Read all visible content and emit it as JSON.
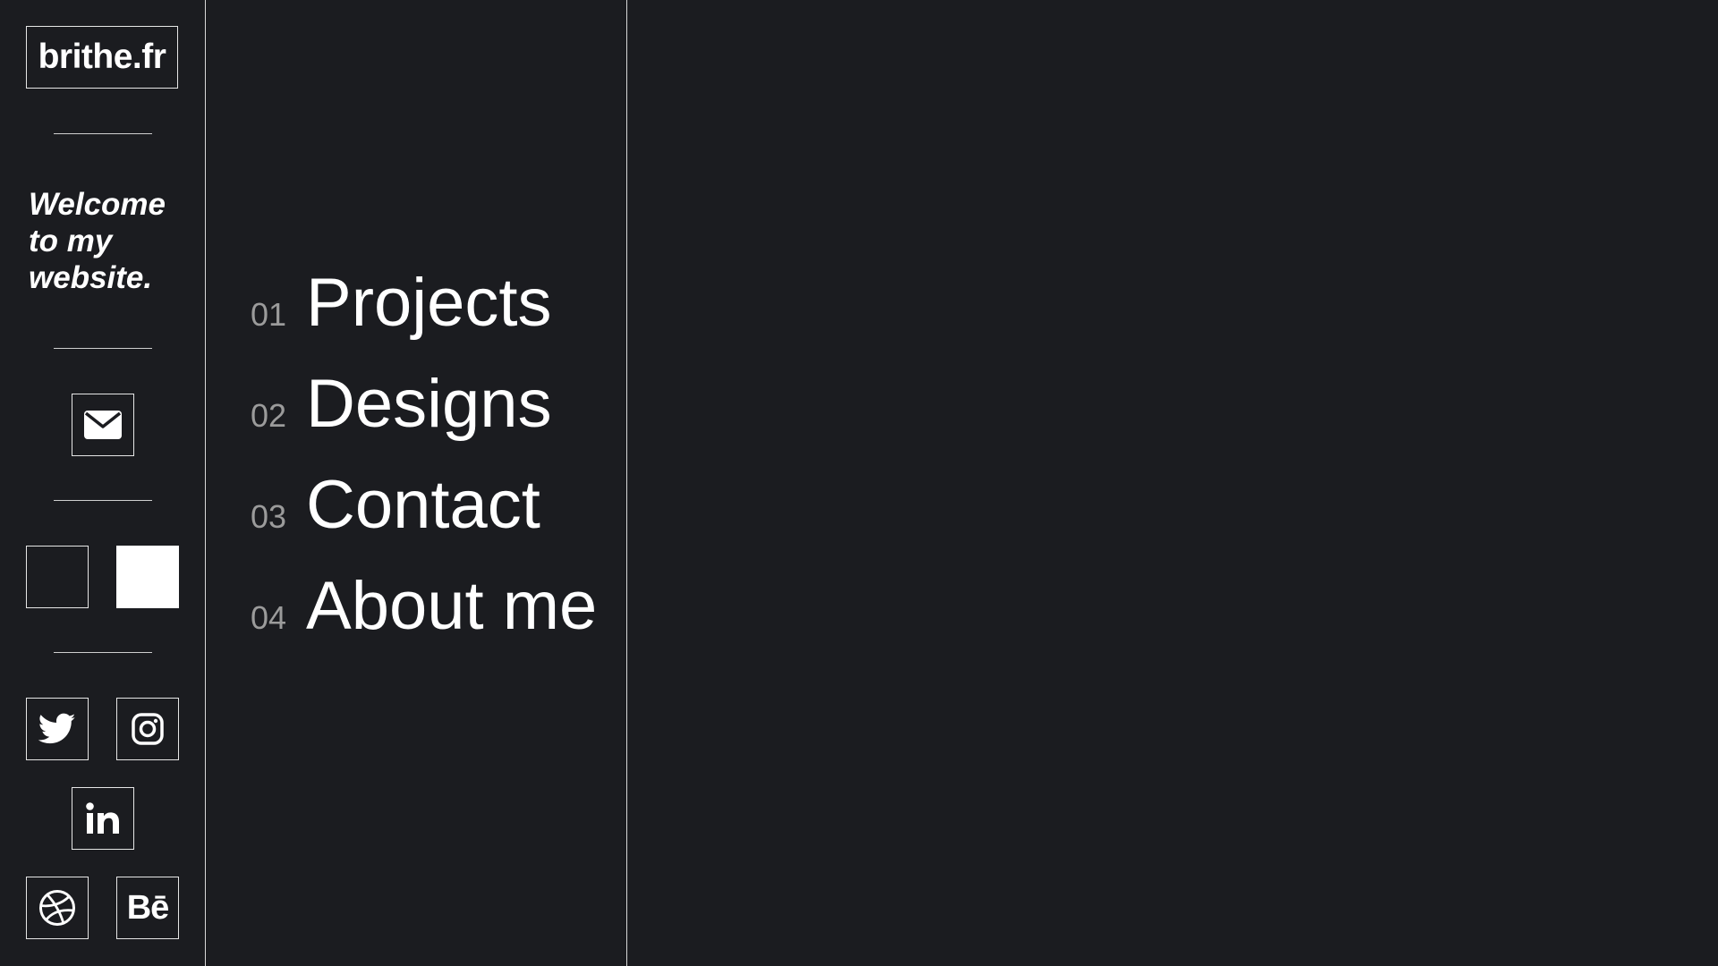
{
  "sidebar": {
    "logo": "brithe.fr",
    "welcome": [
      "Welcome",
      "to my",
      "website."
    ],
    "contact_icon": "envelope-icon",
    "theme_toggles": [
      {
        "name": "theme-dark-toggle",
        "color": "#1b1c20"
      },
      {
        "name": "theme-light-toggle",
        "color": "#ffffff"
      }
    ],
    "socials": [
      "twitter-icon",
      "instagram-icon",
      "linkedin-icon",
      "dribbble-icon",
      "behance-icon"
    ],
    "behance_text": "Bē"
  },
  "nav": {
    "items": [
      {
        "num": "01",
        "label": "Projects"
      },
      {
        "num": "02",
        "label": "Designs"
      },
      {
        "num": "03",
        "label": "Contact"
      },
      {
        "num": "04",
        "label": "About me"
      }
    ]
  },
  "colors": {
    "background": "#1b1c20",
    "text": "#ffffff",
    "muted": "#9b9b9b",
    "border": "#e6e6e6"
  }
}
